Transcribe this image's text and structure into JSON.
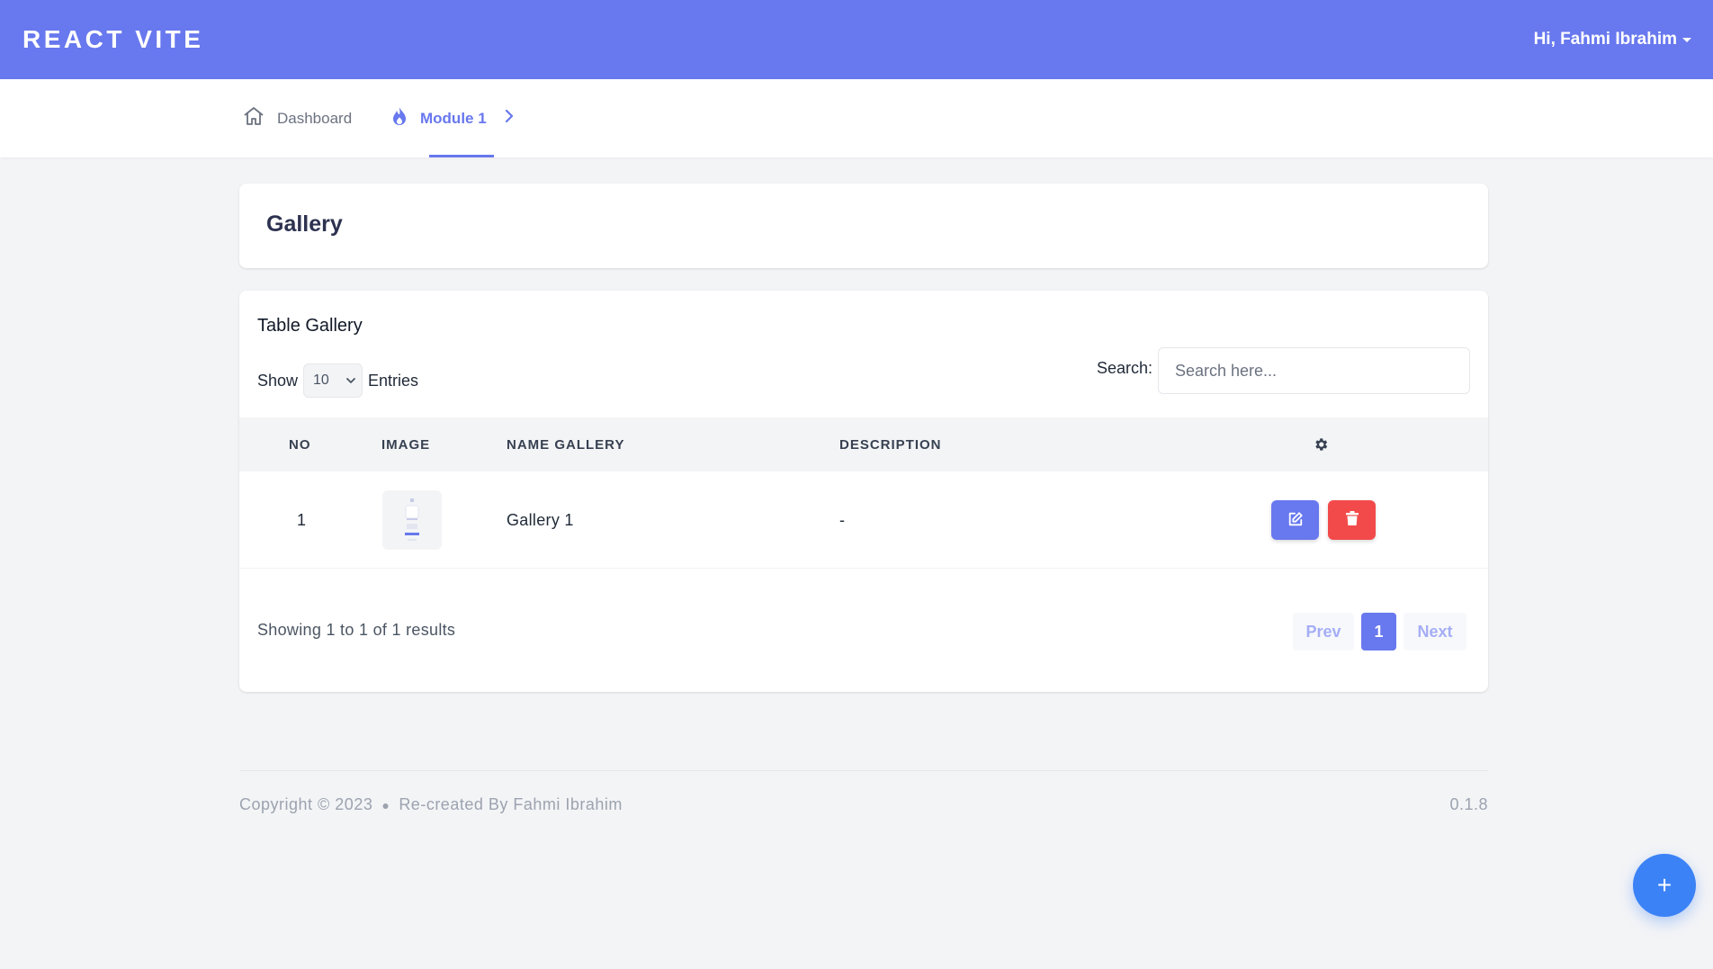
{
  "topbar": {
    "brand": "REACT VITE",
    "user_greeting": "Hi, Fahmi Ibrahim"
  },
  "nav": {
    "items": [
      {
        "label": "Dashboard",
        "icon": "home-icon",
        "active": false
      },
      {
        "label": "Module 1",
        "icon": "fire-icon",
        "active": true
      }
    ]
  },
  "page": {
    "title": "Gallery"
  },
  "table": {
    "title": "Table Gallery",
    "show_label": "Show",
    "entries_value": "10",
    "entries_label": "Entries",
    "search_label": "Search:",
    "search_placeholder": "Search here...",
    "columns": [
      "NO",
      "IMAGE",
      "NAME GALLERY",
      "DESCRIPTION"
    ],
    "actions_column_icon": "gear-icon",
    "rows": [
      {
        "no": "1",
        "image": "gallery-thumbnail",
        "name": "Gallery 1",
        "description": "-"
      }
    ],
    "showing_text": "Showing 1 to 1 of 1 results",
    "pagination": {
      "prev": "Prev",
      "current": "1",
      "next": "Next"
    }
  },
  "footer": {
    "copyright": "Copyright © 2023",
    "credit": "Re-created By Fahmi Ibrahim",
    "version": "0.1.8"
  },
  "fab": {
    "label": "+"
  },
  "colors": {
    "primary": "#6878ee",
    "danger": "#f24a4a",
    "fab": "#3b82f6"
  }
}
